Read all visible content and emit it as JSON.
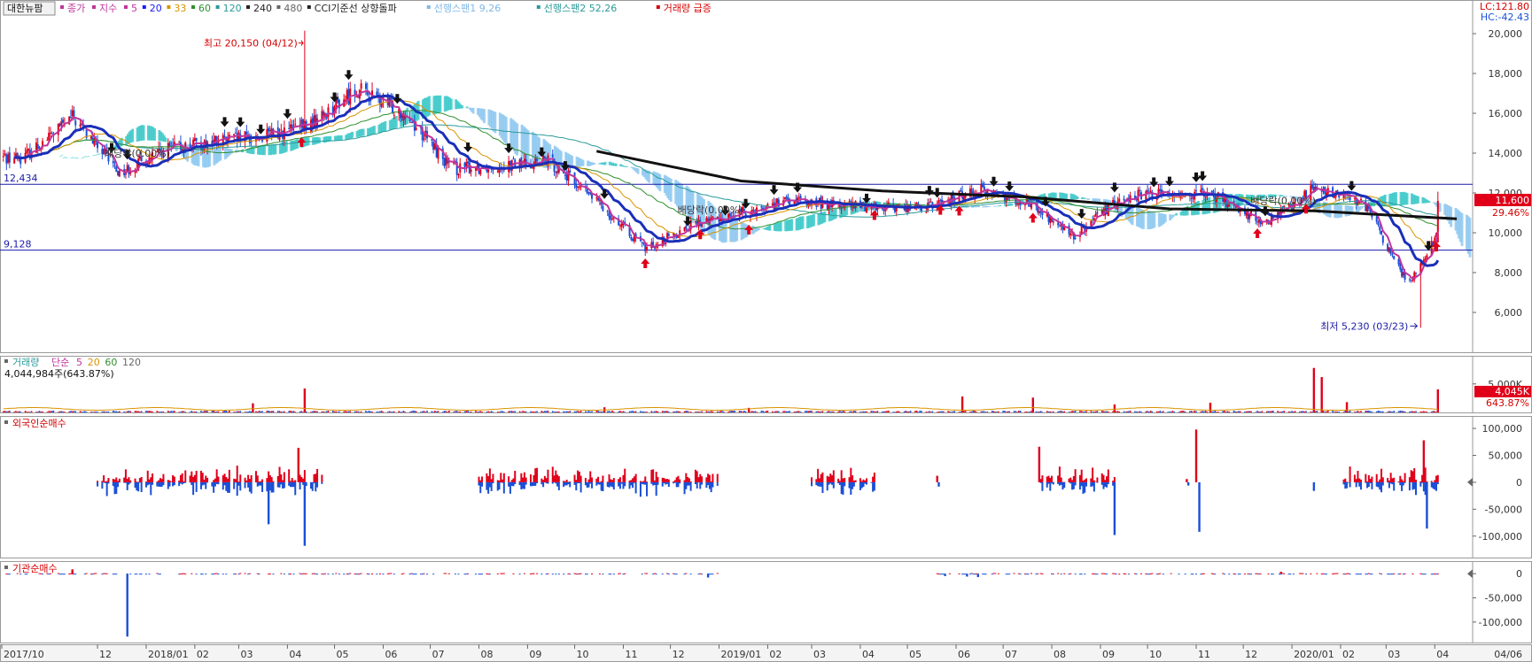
{
  "chart_data": [
    {
      "type": "candlestick",
      "panel": "price",
      "legend": {
        "stock_name": "대한뉴팜",
        "items": [
          {
            "text": "종가",
            "color": "#c0349c"
          },
          {
            "text": "지수",
            "color": "#c0349c"
          },
          {
            "text": "5",
            "color": "#c0349c"
          },
          {
            "text": "20",
            "color": "#1a1aff"
          },
          {
            "text": "33",
            "color": "#d99400"
          },
          {
            "text": "60",
            "color": "#2f8f2f"
          },
          {
            "text": "120",
            "color": "#2a9a9a"
          },
          {
            "text": "240",
            "color": "#222222"
          },
          {
            "text": "480",
            "color": "#666666"
          },
          {
            "text": "CCI기준선 상향돌파",
            "color": "#222222"
          },
          {
            "text": "선행스팬1 9,26",
            "color": "#7fb8e8"
          },
          {
            "text": "선행스팬2 52,26",
            "color": "#2a9a9a"
          },
          {
            "text": "거래량 급증",
            "color": "#d40000"
          }
        ]
      },
      "right_top_labels": {
        "lc": "LC:121.80",
        "hc": "HC:-42.43"
      },
      "ylim": [
        4000,
        20800
      ],
      "y_ticks": [
        6000,
        8000,
        10000,
        12000,
        14000,
        16000,
        18000,
        20000
      ],
      "y_tick_labels": [
        "6,000",
        "8,000",
        "10,000",
        "12,000",
        "14,000",
        "16,000",
        "18,000",
        "20,000"
      ],
      "hlines": [
        {
          "value": 12434,
          "label": "12,434"
        },
        {
          "value": 9128,
          "label": "9,128"
        }
      ],
      "current_price": {
        "value": 11600,
        "label": "11,600",
        "change": "29.46%"
      },
      "max_annotation": {
        "text": "최고 20,150 (04/12)",
        "value": 20150,
        "date": "2018-04-12"
      },
      "min_annotation": {
        "text": "최저 5,230 (03/23)",
        "value": 5230,
        "date": "2020-03-23"
      },
      "dividend_annotations": [
        {
          "text": "배당락(0.00%)",
          "date": "2017-12-27"
        },
        {
          "text": "배당락(0.00%)",
          "date": "2018-12-27"
        },
        {
          "text": "배당락(0.00%)",
          "date": "2019-12-27"
        }
      ],
      "close_series_monthly": {
        "x": [
          "2017-10",
          "2017-11",
          "2017-12",
          "2018-01",
          "2018-02",
          "2018-03",
          "2018-04",
          "2018-05",
          "2018-06",
          "2018-07",
          "2018-08",
          "2018-09",
          "2018-10",
          "2018-11",
          "2018-12",
          "2019-01",
          "2019-02",
          "2019-03",
          "2019-04",
          "2019-05",
          "2019-06",
          "2019-07",
          "2019-08",
          "2019-09",
          "2019-10",
          "2019-11",
          "2019-12",
          "2020-01",
          "2020-02",
          "2020-03",
          "2020-04"
        ],
        "y": [
          13800,
          15800,
          13000,
          14200,
          14600,
          14800,
          15400,
          17200,
          16000,
          13200,
          13400,
          13600,
          11600,
          9200,
          10400,
          11000,
          11600,
          11400,
          11300,
          11300,
          12200,
          11600,
          9800,
          11800,
          12000,
          11800,
          10400,
          12200,
          11600,
          7400,
          11600
        ]
      },
      "ma240_monthly": {
        "x": [
          "2018-10",
          "2019-01",
          "2019-04",
          "2019-07",
          "2019-10",
          "2020-01",
          "2020-04"
        ],
        "y": [
          14100,
          12600,
          12100,
          11800,
          11200,
          11100,
          10700
        ]
      }
    },
    {
      "type": "bar",
      "panel": "volume",
      "legend": {
        "title": "거래량",
        "items": [
          {
            "text": "단순",
            "color": "#c0349c"
          },
          {
            "text": "5",
            "color": "#c0349c"
          },
          {
            "text": "20",
            "color": "#d99400"
          },
          {
            "text": "60",
            "color": "#2f8f2f"
          },
          {
            "text": "120",
            "color": "#666666"
          }
        ],
        "value_text": "4,044,984주(643.87%)"
      },
      "y_ticks": [
        5000
      ],
      "y_tick_labels": [
        "5,000K"
      ],
      "current": {
        "label": "4,045K",
        "change": "643.87%"
      },
      "spikes": [
        {
          "date": "2018-03-10",
          "value": 1600
        },
        {
          "date": "2018-04-12",
          "value": 4200
        },
        {
          "date": "2018-10-20",
          "value": 900
        },
        {
          "date": "2019-01-20",
          "value": 800
        },
        {
          "date": "2019-06-05",
          "value": 2800
        },
        {
          "date": "2019-07-20",
          "value": 2600
        },
        {
          "date": "2019-09-10",
          "value": 1400
        },
        {
          "date": "2019-11-10",
          "value": 1700
        },
        {
          "date": "2020-01-15",
          "value": 7800
        },
        {
          "date": "2020-01-20",
          "value": 6200
        },
        {
          "date": "2020-02-05",
          "value": 1800
        },
        {
          "date": "2020-04-03",
          "value": 4045
        }
      ]
    },
    {
      "type": "bar",
      "panel": "foreign_net_buy",
      "title": "외국인순매수",
      "ylim": [
        -130000,
        110000
      ],
      "y_ticks": [
        100000,
        50000,
        0,
        -50000,
        -100000
      ],
      "y_tick_labels": [
        "100,000",
        "50,000",
        "0",
        "-50,000",
        "-100,000"
      ],
      "clusters": [
        {
          "start": "2017-12-01",
          "end": "2018-04-23",
          "seed": 3
        },
        {
          "start": "2018-08-01",
          "end": "2018-12-31",
          "seed": 7
        },
        {
          "start": "2019-03-01",
          "end": "2019-04-10",
          "seed": 11
        },
        {
          "start": "2019-07-25",
          "end": "2019-09-10",
          "seed": 5
        },
        {
          "start": "2020-02-01",
          "end": "2020-04-03",
          "seed": 9
        }
      ],
      "spikes": [
        {
          "date": "2018-04-12",
          "value": -118000
        },
        {
          "date": "2018-04-08",
          "value": 64000
        },
        {
          "date": "2018-03-20",
          "value": -78000
        },
        {
          "date": "2019-05-20",
          "value": 12000
        },
        {
          "date": "2019-05-21",
          "value": -8000
        },
        {
          "date": "2019-07-24",
          "value": 66000
        },
        {
          "date": "2019-09-10",
          "value": -98000
        },
        {
          "date": "2019-11-01",
          "value": 98000
        },
        {
          "date": "2019-11-03",
          "value": -92000
        },
        {
          "date": "2019-10-26",
          "value": 6000
        },
        {
          "date": "2019-10-27",
          "value": -6000
        },
        {
          "date": "2020-01-15",
          "value": -16000
        },
        {
          "date": "2020-03-25",
          "value": 78000
        },
        {
          "date": "2020-03-27",
          "value": -86000
        }
      ]
    },
    {
      "type": "bar",
      "panel": "institution_net_buy",
      "title": "기관순매수",
      "ylim": [
        -135000,
        15000
      ],
      "y_ticks": [
        0,
        -50000,
        -100000
      ],
      "y_tick_labels": [
        "0",
        "-50,000",
        "-100,000"
      ],
      "spikes": [
        {
          "date": "2017-12-20",
          "value": -130000
        },
        {
          "date": "2017-11-15",
          "value": 9000
        },
        {
          "date": "2018-12-25",
          "value": -8000
        },
        {
          "date": "2019-05-25",
          "value": -5000
        },
        {
          "date": "2019-06-08",
          "value": -6000
        },
        {
          "date": "2019-06-15",
          "value": -7000
        },
        {
          "date": "2019-12-25",
          "value": 4000
        }
      ],
      "active_ranges": [
        {
          "start": "2017-10-01",
          "end": "2018-12-31"
        },
        {
          "start": "2019-05-20",
          "end": "2020-04-03"
        }
      ]
    }
  ],
  "x_axis": {
    "start": "2017-10-01",
    "end": "2020-04-06",
    "labels": [
      {
        "date": "2017-10-01",
        "text": "2017/10"
      },
      {
        "date": "2017-12-01",
        "text": "12"
      },
      {
        "date": "2018-01-01",
        "text": "2018/01"
      },
      {
        "date": "2018-02-01",
        "text": "02"
      },
      {
        "date": "2018-03-01",
        "text": "03"
      },
      {
        "date": "2018-04-01",
        "text": "04"
      },
      {
        "date": "2018-05-01",
        "text": "05"
      },
      {
        "date": "2018-06-01",
        "text": "06"
      },
      {
        "date": "2018-07-01",
        "text": "07"
      },
      {
        "date": "2018-08-01",
        "text": "08"
      },
      {
        "date": "2018-09-01",
        "text": "09"
      },
      {
        "date": "2018-10-01",
        "text": "10"
      },
      {
        "date": "2018-11-01",
        "text": "11"
      },
      {
        "date": "2018-12-01",
        "text": "12"
      },
      {
        "date": "2019-01-01",
        "text": "2019/01"
      },
      {
        "date": "2019-02-01",
        "text": "02"
      },
      {
        "date": "2019-03-01",
        "text": "03"
      },
      {
        "date": "2019-04-01",
        "text": "04"
      },
      {
        "date": "2019-05-01",
        "text": "05"
      },
      {
        "date": "2019-06-01",
        "text": "06"
      },
      {
        "date": "2019-07-01",
        "text": "07"
      },
      {
        "date": "2019-08-01",
        "text": "08"
      },
      {
        "date": "2019-09-01",
        "text": "09"
      },
      {
        "date": "2019-10-01",
        "text": "10"
      },
      {
        "date": "2019-11-01",
        "text": "11"
      },
      {
        "date": "2019-12-01",
        "text": "12"
      },
      {
        "date": "2020-01-01",
        "text": "2020/01"
      },
      {
        "date": "2020-02-01",
        "text": "02"
      },
      {
        "date": "2020-03-01",
        "text": "03"
      },
      {
        "date": "2020-04-01",
        "text": "04"
      }
    ],
    "right_label": "04/06"
  },
  "colors": {
    "up": "#e0001a",
    "down": "#1a4fd6",
    "hline": "#1a1aa8",
    "grid": "#e6e6e6",
    "cloud_a": "#3cc8c8",
    "cloud_b": "#8ec8f0",
    "ma5": "#c0349c",
    "ma20": "#1a2fb8",
    "ma240": "#111111",
    "panel_border": "#9a9a9a"
  }
}
